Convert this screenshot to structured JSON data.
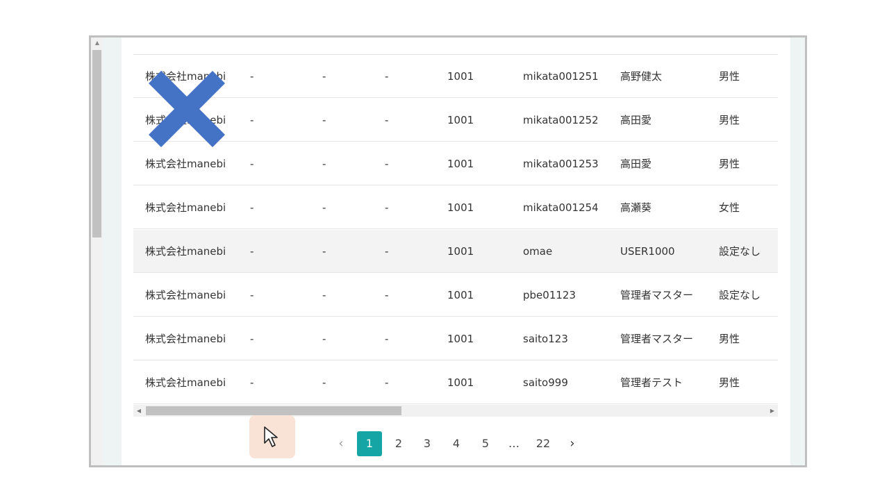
{
  "table": {
    "rows": [
      {
        "company": "株式会社manebi",
        "col2": "-",
        "col3": "-",
        "col4": "-",
        "code": "1001",
        "user_id": "mikata001251",
        "name": "高野健太",
        "gender": "男性"
      },
      {
        "company": "株式会社manebi",
        "col2": "-",
        "col3": "-",
        "col4": "-",
        "code": "1001",
        "user_id": "mikata001252",
        "name": "高田愛",
        "gender": "男性"
      },
      {
        "company": "株式会社manebi",
        "col2": "-",
        "col3": "-",
        "col4": "-",
        "code": "1001",
        "user_id": "mikata001253",
        "name": "高田愛",
        "gender": "男性"
      },
      {
        "company": "株式会社manebi",
        "col2": "-",
        "col3": "-",
        "col4": "-",
        "code": "1001",
        "user_id": "mikata001254",
        "name": "高瀬葵",
        "gender": "女性"
      },
      {
        "company": "株式会社manebi",
        "col2": "-",
        "col3": "-",
        "col4": "-",
        "code": "1001",
        "user_id": "omae",
        "name": "USER1000",
        "gender": "設定なし"
      },
      {
        "company": "株式会社manebi",
        "col2": "-",
        "col3": "-",
        "col4": "-",
        "code": "1001",
        "user_id": "pbe01123",
        "name": "管理者マスター",
        "gender": "設定なし"
      },
      {
        "company": "株式会社manebi",
        "col2": "-",
        "col3": "-",
        "col4": "-",
        "code": "1001",
        "user_id": "saito123",
        "name": "管理者マスター",
        "gender": "男性"
      },
      {
        "company": "株式会社manebi",
        "col2": "-",
        "col3": "-",
        "col4": "-",
        "code": "1001",
        "user_id": "saito999",
        "name": "管理者テスト",
        "gender": "男性"
      }
    ],
    "highlighted_row": 4
  },
  "pagination": {
    "prev": "‹",
    "pages": [
      "1",
      "2",
      "3",
      "4",
      "5"
    ],
    "ellipsis": "…",
    "last": "22",
    "next": "›",
    "current": "1"
  },
  "colors": {
    "accent": "#16a5a5",
    "x_mark": "#4472c4",
    "cursor_highlight": "#f9e3d6"
  },
  "icons": {
    "overlay": "x-mark-icon",
    "pointer": "mouse-pointer-icon"
  }
}
